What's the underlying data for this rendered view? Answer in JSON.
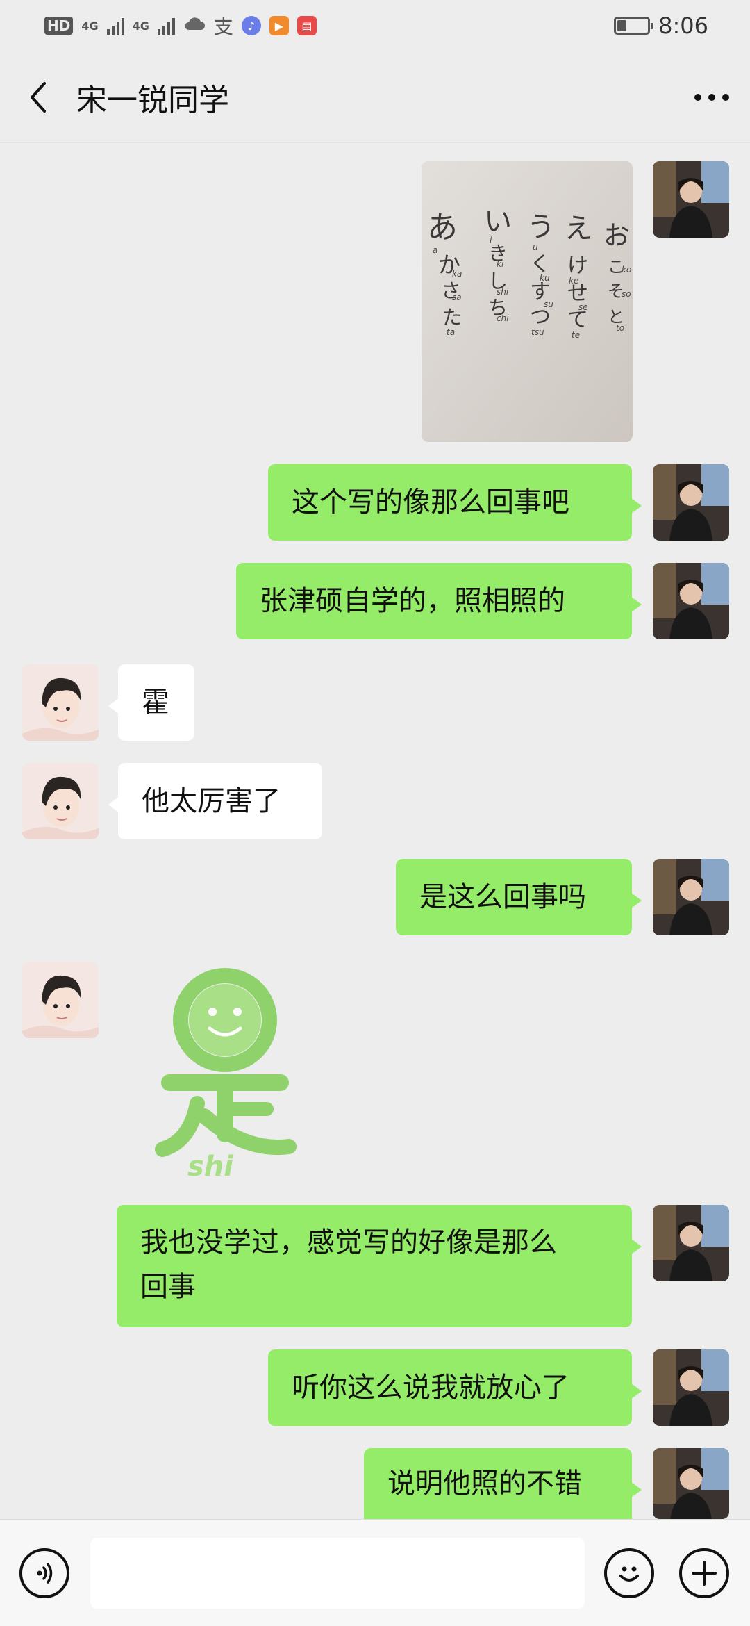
{
  "status_bar": {
    "hd": "HD",
    "net1": "4G",
    "net2": "4G",
    "alipay": "支",
    "time": "8:06",
    "battery_level": 0.3
  },
  "nav": {
    "title": "宋一锐同学"
  },
  "image_note": {
    "row1": [
      "お",
      "こ",
      "そ",
      "と"
    ],
    "row1_roman": [
      "o",
      "ko",
      "so",
      "to"
    ],
    "row2": [
      "え",
      "け",
      "せ",
      "て"
    ],
    "row2_roman": [
      "e",
      "ke",
      "se",
      "te"
    ],
    "row3": [
      "う",
      "く",
      "す",
      "つ"
    ],
    "row3_roman": [
      "u",
      "ku",
      "su",
      "tsu"
    ],
    "row4": [
      "い",
      "き",
      "し",
      "ち"
    ],
    "row4_roman": [
      "i",
      "ki",
      "shi",
      "chi"
    ],
    "row5": [
      "あ",
      "か",
      "さ",
      "た"
    ],
    "row5_roman": [
      "a",
      "ka",
      "sa",
      "ta"
    ]
  },
  "messages": [
    {
      "side": "right",
      "type": "image"
    },
    {
      "side": "right",
      "type": "text",
      "text": "这个写的像那么回事吧"
    },
    {
      "side": "right",
      "type": "text",
      "text": "张津硕自学的，照相照的"
    },
    {
      "side": "left",
      "type": "text",
      "text": "霍"
    },
    {
      "side": "left",
      "type": "text",
      "text": "他太厉害了"
    },
    {
      "side": "right",
      "type": "text",
      "text": "是这么回事吗"
    },
    {
      "side": "left",
      "type": "sticker",
      "sticker_label": "shi"
    },
    {
      "side": "right",
      "type": "text",
      "text_line1": "我也没学过，感觉写的好像是那么",
      "text_line2": "回事"
    },
    {
      "side": "right",
      "type": "text",
      "text": "听你这么说我就放心了"
    },
    {
      "side": "right",
      "type": "text",
      "text": "说明他照的不错"
    }
  ],
  "colors": {
    "bubble_self": "#95ec69",
    "bubble_other": "#ffffff",
    "background": "#ededed",
    "sticker_green": "#8fd16a"
  },
  "icons": {
    "voice": "voice-icon",
    "emoji": "emoji-icon",
    "plus": "plus-icon",
    "back": "back-arrow-icon",
    "more": "more-icon"
  }
}
